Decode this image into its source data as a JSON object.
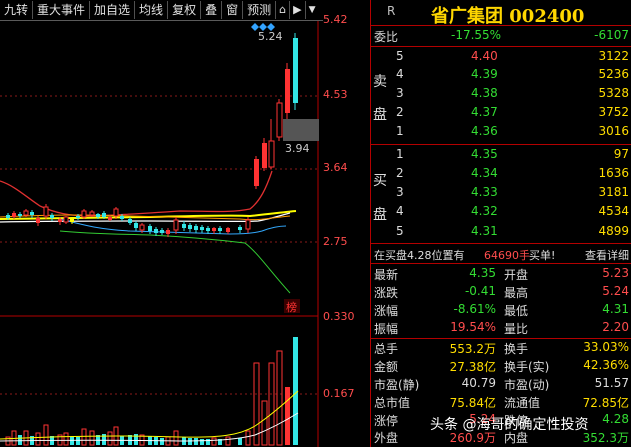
{
  "toolbar": {
    "items": [
      "九转",
      "重大事件",
      "加自选",
      "均线",
      "复权",
      "叠",
      "窗",
      "预测"
    ],
    "dropdown": "▼"
  },
  "chart": {
    "price_labels": [
      "5.42",
      "4.53",
      "3.64",
      "2.75",
      "0.330",
      "0.167"
    ],
    "callouts": [
      "5.24",
      "3.94"
    ],
    "tag": "榜"
  },
  "header": {
    "r": "R",
    "title": "省广集团 002400"
  },
  "weibi": {
    "label": "委比",
    "pct": "-17.55%",
    "diff": "-6107"
  },
  "sell_label": [
    "卖",
    "盘"
  ],
  "buy_label": [
    "买",
    "盘"
  ],
  "sell": [
    {
      "n": "5",
      "price": "4.40",
      "vol": "3122"
    },
    {
      "n": "4",
      "price": "4.39",
      "vol": "5236"
    },
    {
      "n": "3",
      "price": "4.38",
      "vol": "5328"
    },
    {
      "n": "2",
      "price": "4.37",
      "vol": "3752"
    },
    {
      "n": "1",
      "price": "4.36",
      "vol": "3016"
    }
  ],
  "buy": [
    {
      "n": "1",
      "price": "4.35",
      "vol": "97"
    },
    {
      "n": "2",
      "price": "4.34",
      "vol": "1636"
    },
    {
      "n": "3",
      "price": "4.33",
      "vol": "3181"
    },
    {
      "n": "4",
      "price": "4.32",
      "vol": "4534"
    },
    {
      "n": "5",
      "price": "4.31",
      "vol": "4899"
    }
  ],
  "status": {
    "text": "在买盘4.28位置有",
    "vol": "64690手",
    "tail": "买单!",
    "link": "查看详细"
  },
  "stats": [
    {
      "l1": "最新",
      "v1": "4.35",
      "c1": "green",
      "l2": "开盘",
      "v2": "5.23",
      "c2": "red"
    },
    {
      "l1": "涨跌",
      "v1": "-0.41",
      "c1": "green",
      "l2": "最高",
      "v2": "5.24",
      "c2": "red"
    },
    {
      "l1": "涨幅",
      "v1": "-8.61%",
      "c1": "green",
      "l2": "最低",
      "v2": "4.31",
      "c2": "green"
    },
    {
      "l1": "振幅",
      "v1": "19.54%",
      "c1": "red",
      "l2": "量比",
      "v2": "2.20",
      "c2": "red"
    },
    {
      "l1": "总手",
      "v1": "553.2万",
      "c1": "yellow",
      "l2": "换手",
      "v2": "33.03%",
      "c2": "yellow"
    },
    {
      "l1": "金额",
      "v1": "27.38亿",
      "c1": "yellow",
      "l2": "换手(实)",
      "v2": "42.36%",
      "c2": "yellow"
    },
    {
      "l1": "市盈(静)",
      "v1": "40.79",
      "c1": "white",
      "l2": "市盈(动)",
      "v2": "51.57",
      "c2": "white"
    },
    {
      "l1": "总市值",
      "v1": "75.84亿",
      "c1": "yellow",
      "l2": "流通值",
      "v2": "72.85亿",
      "c2": "yellow"
    },
    {
      "l1": "涨停",
      "v1": "5.24",
      "c1": "red",
      "l2": "跌停",
      "v2": "4.28",
      "c2": "green"
    },
    {
      "l1": "外盘",
      "v1": "260.9万",
      "c1": "red",
      "l2": "内盘",
      "v2": "352.3万",
      "c2": "green"
    }
  ],
  "watermark": "头条 @海哥的确定性投资"
}
